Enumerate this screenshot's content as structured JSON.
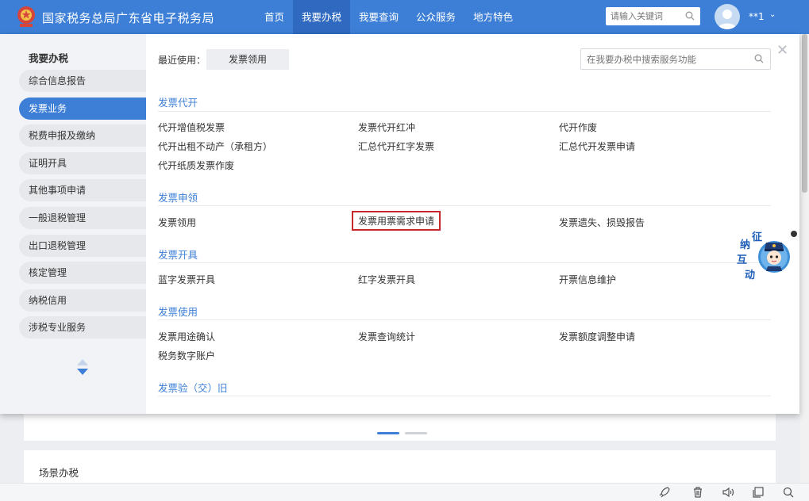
{
  "header": {
    "site_title": "国家税务总局广东省电子税务局",
    "nav": [
      "首页",
      "我要办税",
      "我要查询",
      "公众服务",
      "地方特色"
    ],
    "search_placeholder": "请输入关键词",
    "username": "**1"
  },
  "panel": {
    "sidebar_title": "我要办税",
    "sidebar_items": [
      "综合信息报告",
      "发票业务",
      "税费申报及缴纳",
      "证明开具",
      "其他事项申请",
      "一般退税管理",
      "出口退税管理",
      "核定管理",
      "纳税信用",
      "涉税专业服务"
    ],
    "active_sidebar_index": 1,
    "recent_label": "最近使用：",
    "recent_items": [
      "发票领用"
    ],
    "search_placeholder": "在我要办税中搜索服务功能",
    "sections": [
      {
        "title": "发票代开",
        "links": [
          "代开增值税发票",
          "发票代开红冲",
          "代开作废",
          "代开出租不动产（承租方）",
          "汇总代开红字发票",
          "汇总代开发票申请",
          "代开纸质发票作废"
        ]
      },
      {
        "title": "发票申领",
        "links": [
          "发票领用",
          "发票用票需求申请",
          "发票遗失、损毁报告"
        ]
      },
      {
        "title": "发票开具",
        "links": [
          "蓝字发票开具",
          "红字发票开具",
          "开票信息维护"
        ]
      },
      {
        "title": "发票使用",
        "links": [
          "发票用途确认",
          "发票查询统计",
          "发票额度调整申请",
          "税务数字账户"
        ]
      },
      {
        "title": "发票验（交）旧",
        "links": []
      }
    ]
  },
  "mascot": {
    "chars": [
      "征",
      "纳",
      "互",
      "动"
    ]
  },
  "background": {
    "card_title": "场景办税"
  },
  "colors": {
    "primary": "#3d7fd6",
    "highlight_border": "#c8282d",
    "header_active": "#2f6ac0"
  }
}
